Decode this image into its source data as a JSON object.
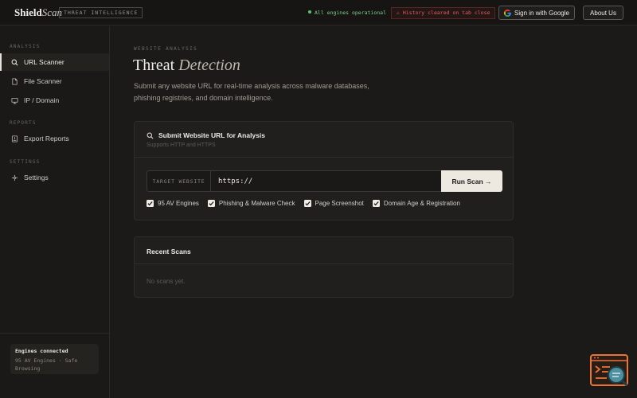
{
  "topbar": {
    "logo_bold": "Shield",
    "logo_italic": "Scan",
    "tag": "THREAT INTELLIGENCE",
    "engines_status": "All engines operational",
    "history_notice": "⚠ History cleared on tab close",
    "google_button": "Sign in with Google",
    "about_button": "About Us"
  },
  "sidebar": {
    "sections": [
      {
        "label": "ANALYSIS"
      },
      {
        "label": "REPORTS"
      },
      {
        "label": "SETTINGS"
      }
    ],
    "items": [
      {
        "label": "URL Scanner",
        "icon": "search-icon"
      },
      {
        "label": "File Scanner",
        "icon": "file-icon"
      },
      {
        "label": "IP / Domain",
        "icon": "monitor-icon"
      },
      {
        "label": "Export Reports",
        "icon": "export-icon"
      },
      {
        "label": "Settings",
        "icon": "gear-icon"
      }
    ],
    "footer": {
      "title": "Engines connected",
      "subtitle": "95 AV Engines · Safe Browsing"
    }
  },
  "main": {
    "eyebrow": "WEBSITE ANALYSIS",
    "title_plain": "Threat",
    "title_italic": "Detection",
    "subtitle": "Submit any website URL for real-time analysis across malware databases, phishing registries, and domain intelligence.",
    "submit_card": {
      "title": "Submit Website URL for Analysis",
      "subtitle": "Supports HTTP and HTTPS",
      "input_prefix": "TARGET WEBSITE",
      "input_value": "https://",
      "run_button": "Run Scan →",
      "options": [
        {
          "label": "95 AV Engines",
          "checked": true
        },
        {
          "label": "Phishing & Malware Check",
          "checked": true
        },
        {
          "label": "Page Screenshot",
          "checked": true
        },
        {
          "label": "Domain Age & Registration",
          "checked": true
        }
      ]
    },
    "recent_card": {
      "title": "Recent Scans",
      "empty_text": "No scans yet."
    }
  },
  "colors": {
    "background": "#1b1a19",
    "status_green": "#5ec46a",
    "warning_red": "#e0625a",
    "accent_orange": "#e8743a"
  }
}
